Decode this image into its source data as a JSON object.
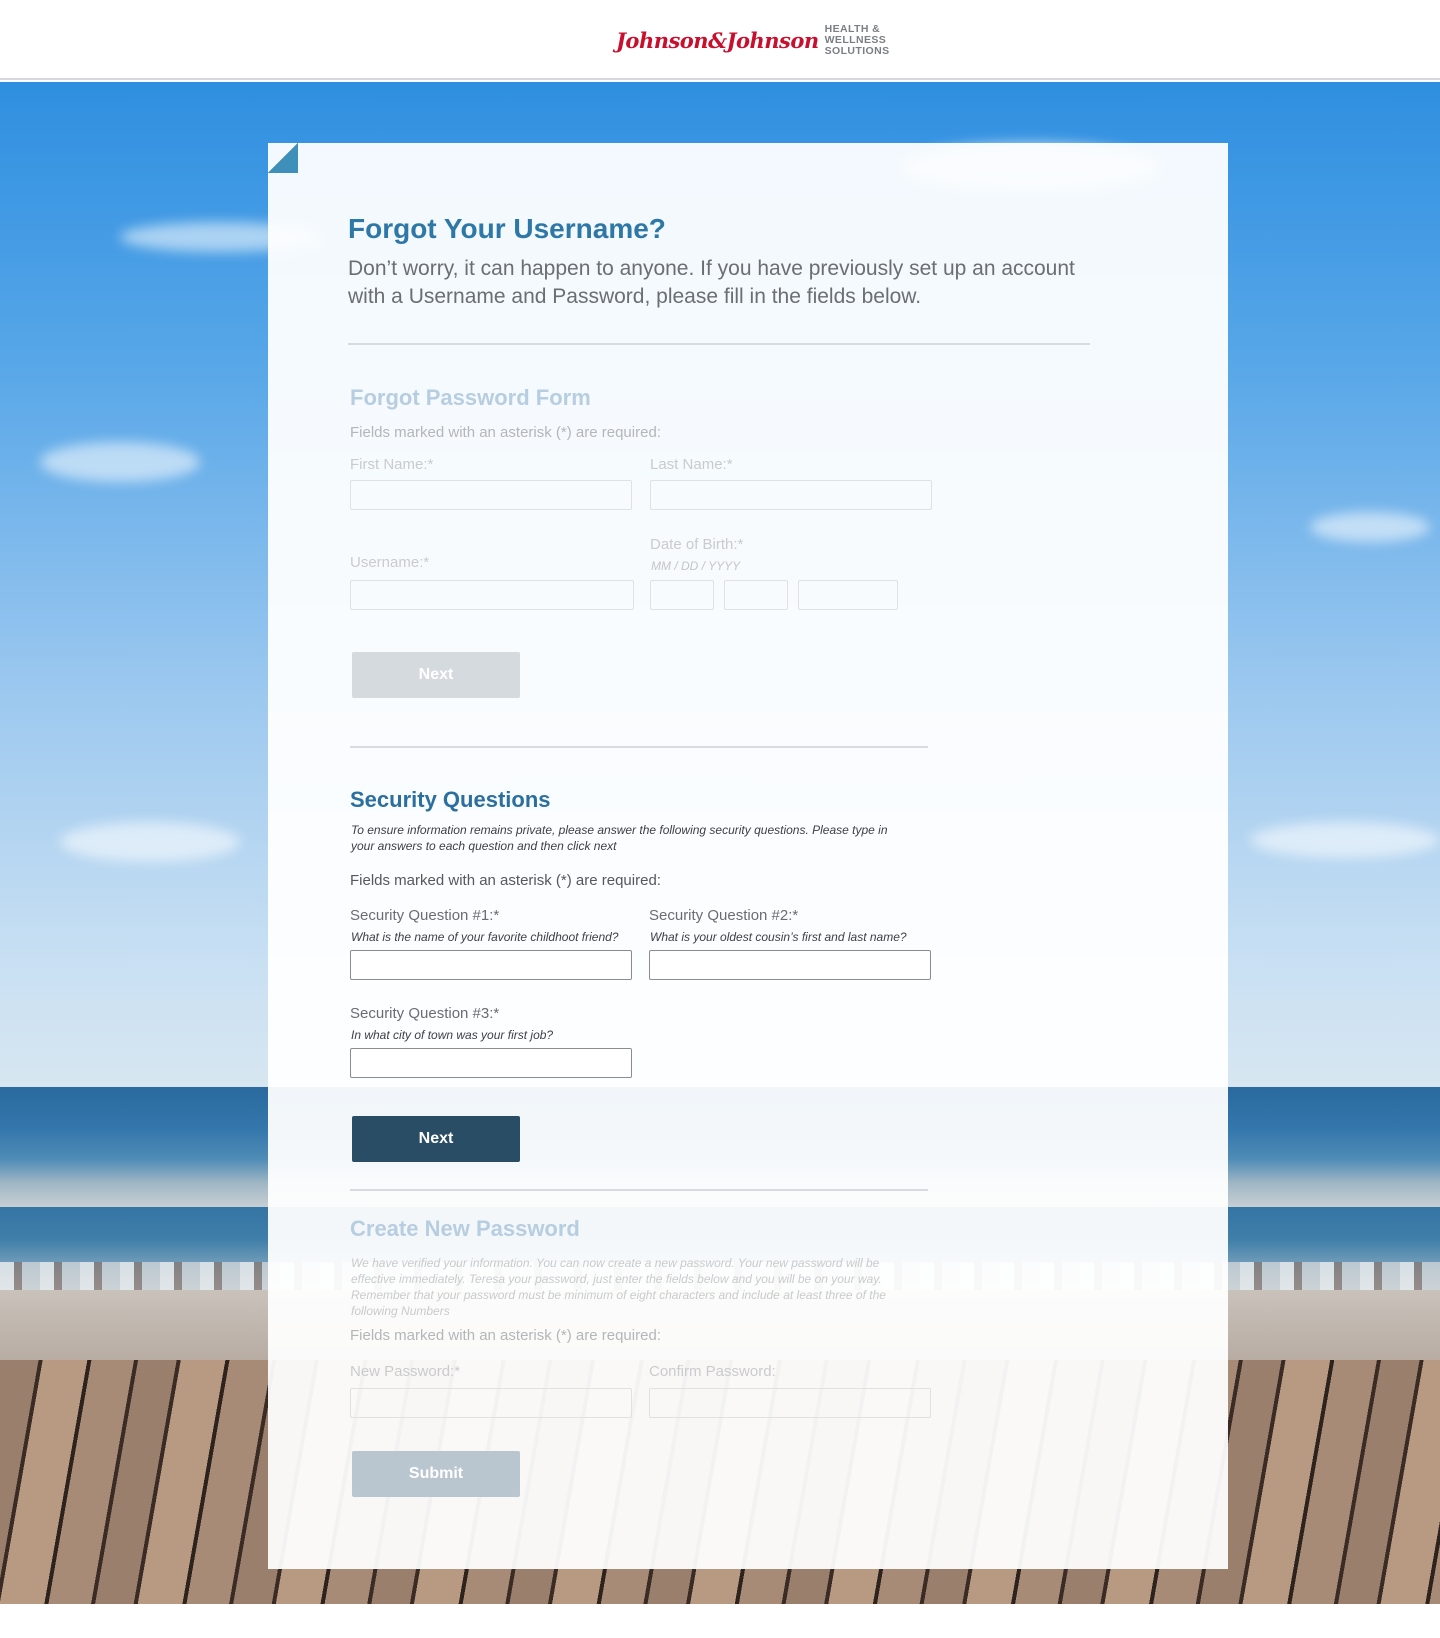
{
  "header": {
    "logo_script": "Johnson&Johnson",
    "logo_tag": [
      "HEALTH &",
      "WELLNESS",
      "SOLUTIONS"
    ]
  },
  "page": {
    "title": "Forgot Your Username?",
    "intro": "Don’t worry, it can happen to anyone.  If you have previously set up an account with a Username and Password, please fill in the fields below."
  },
  "forgot_form": {
    "title": "Forgot Password Form",
    "required_note": "Fields marked with an asterisk (*) are required:",
    "first_name_label": "First Name:*",
    "last_name_label": "Last Name:*",
    "username_label": "Username:*",
    "dob_label": "Date of Birth:*",
    "dob_hint": "MM / DD / YYYY",
    "next_label": "Next"
  },
  "security": {
    "title": "Security Questions",
    "description": "To ensure information remains private, please answer the following security questions. Please type in your answers to each question and then click next",
    "required_note": "Fields marked with an asterisk (*) are required:",
    "q1_label": "Security Question #1:*",
    "q1_text": "What is the name of your favorite childhoot friend?",
    "q2_label": "Security Question #2:*",
    "q2_text": "What is your oldest cousin’s first and last name?",
    "q3_label": "Security Question #3:*",
    "q3_text": "In what city of town was your first job?",
    "next_label": "Next"
  },
  "new_password": {
    "title": "Create New Password",
    "description": "We have verified your information. You can now create a new password. Your new password will be effective immediately. Teresa your password, just enter the fields below and you will be on your way. Remember that your password must be minimum of eight characters and include at least three of the following Numbers",
    "required_note": "Fields marked with an asterisk (*) are required:",
    "new_label": "New Password:*",
    "confirm_label": "Confirm Password:",
    "submit_label": "Submit"
  },
  "colors": {
    "accent": "#2e78a8",
    "primary_button": "#2a4d66",
    "brand_red": "#c8102e"
  }
}
